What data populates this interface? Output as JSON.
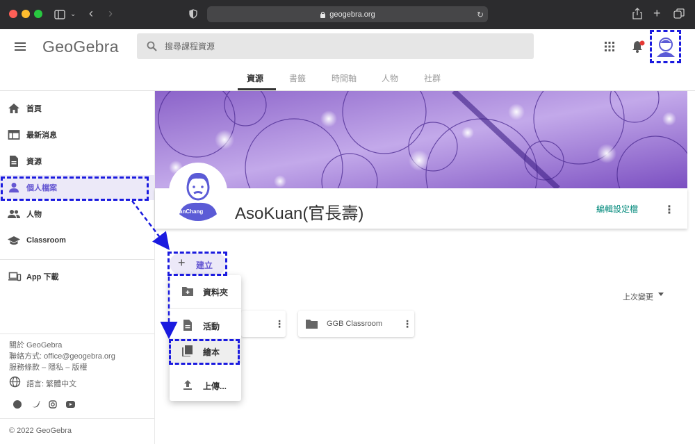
{
  "browser": {
    "url": "geogebra.org",
    "colors": {
      "close": "#fe5f57",
      "minimize": "#febc2e",
      "maximize": "#28c840"
    }
  },
  "header": {
    "logo": "GeoGebra",
    "search": {
      "placeholder": "搜尋課程資源",
      "value": ""
    },
    "tabs": [
      {
        "label": "資源",
        "active": true
      },
      {
        "label": "書籤",
        "active": false
      },
      {
        "label": "時間軸",
        "active": false
      },
      {
        "label": "人物",
        "active": false
      },
      {
        "label": "社群",
        "active": false
      }
    ],
    "icons": [
      "menu-icon",
      "apps-grid-icon",
      "notification-bell-icon",
      "user-avatar"
    ]
  },
  "sidebar": {
    "items": [
      {
        "label": "首頁",
        "icon": "home-icon"
      },
      {
        "label": "最新消息",
        "icon": "news-icon"
      },
      {
        "label": "資源",
        "icon": "document-icon"
      },
      {
        "label": "個人檔案",
        "icon": "person-icon",
        "selected": true
      },
      {
        "label": "人物",
        "icon": "people-icon"
      },
      {
        "label": "Classroom",
        "icon": "school-icon"
      },
      {
        "label": "App 下載",
        "icon": "devices-icon"
      }
    ],
    "footer": {
      "about": "關於 GeoGebra",
      "contact": "聯絡方式: office@geogebra.org",
      "terms": "服務條款 – 隱私 – 版權",
      "language": "語言: 繁體中文",
      "copyright": "© 2022 GeoGebra",
      "social": [
        "facebook-icon",
        "twitter-icon",
        "instagram-icon",
        "youtube-icon"
      ]
    }
  },
  "profile": {
    "name": "AsoKuan(官長壽)",
    "avatar_caption": "anChang",
    "edit_label": "編輯設定檔"
  },
  "main": {
    "create_label": "建立",
    "sort_label": "上次變更",
    "cards": [
      {
        "name": ""
      },
      {
        "name": "GGB Classroom"
      }
    ]
  },
  "create_menu": {
    "items": [
      {
        "label": "資料夾",
        "icon": "new-folder-icon"
      },
      {
        "label": "活動",
        "icon": "activity-icon"
      },
      {
        "label": "繪本",
        "icon": "book-icon",
        "highlighted": true
      },
      {
        "label": "上傳...",
        "icon": "upload-icon"
      }
    ]
  },
  "colors": {
    "accent": "#6557d2",
    "teal": "#00897b",
    "annotation": "#1a1adf",
    "notification_dot": "#e53935"
  }
}
